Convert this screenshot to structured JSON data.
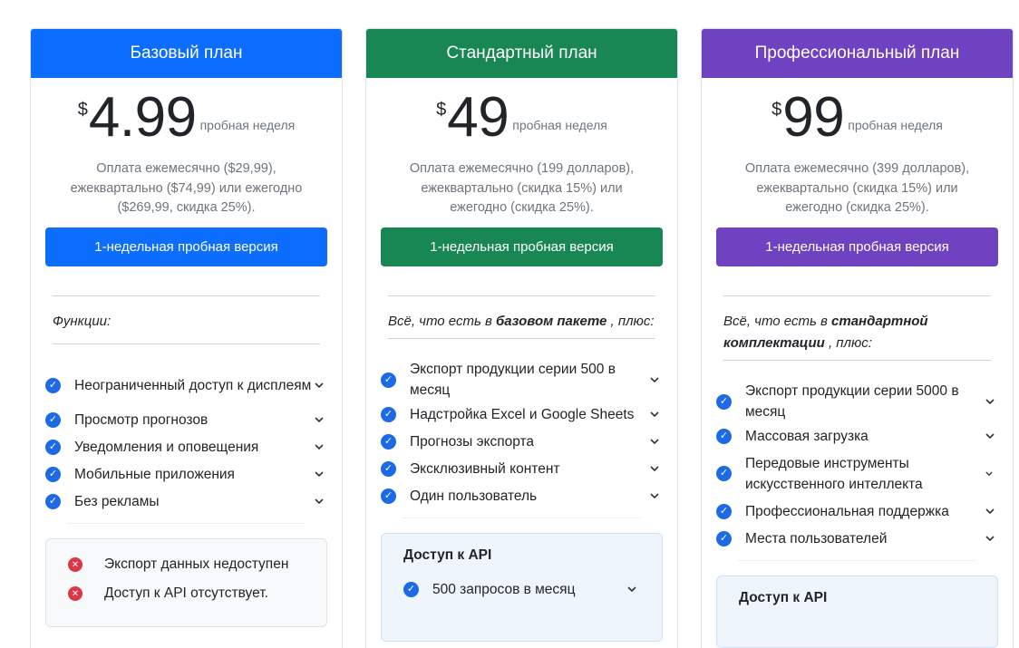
{
  "plans": [
    {
      "header": "Базовый план",
      "color": "#0d6efd",
      "currency": "$",
      "amount": "4.99",
      "period": "пробная неделя",
      "desc": [
        "Оплата ежемесячно ($29,99),",
        "ежеквартально ($74,99) или ежегодно",
        "($269,99, скидка 25%)."
      ],
      "cta": "1-недельная пробная версия",
      "intro_plain": "Функции:",
      "features": [
        "Неограниченный доступ к дисплеям",
        "Просмотр прогнозов",
        "Уведомления и оповещения",
        "Мобильные приложения",
        "Без рекламы"
      ],
      "negatives": [
        "Экспорт данных недоступен",
        "Доступ к API отсутствует."
      ]
    },
    {
      "header": "Стандартный план",
      "color": "#198754",
      "currency": "$",
      "amount": "49",
      "period": "пробная неделя",
      "desc": [
        "Оплата ежемесячно (199 долларов),",
        "ежеквартально (скидка 15%) или",
        "ежегодно (скидка 25%)."
      ],
      "cta": "1-недельная пробная версия",
      "intro_pre": "Всё, что есть в",
      "intro_bold": "базовом пакете",
      "intro_post": ", плюс:",
      "features": [
        "Экспорт продукции серии 500 в месяц",
        "Надстройка Excel и Google Sheets",
        "Прогнозы экспорта",
        "Эксклюзивный контент",
        "Один пользователь"
      ],
      "api_title": "Доступ к API",
      "api_features": [
        "500 запросов в месяц"
      ]
    },
    {
      "header": "Профессиональный план",
      "color": "#6f42c1",
      "currency": "$",
      "amount": "99",
      "period": "пробная неделя",
      "desc": [
        "Оплата ежемесячно (399 долларов),",
        "ежеквартально (скидка 15%) или",
        "ежегодно (скидка 25%)."
      ],
      "cta": "1-недельная пробная версия",
      "intro_pre": "Всё, что есть в",
      "intro_bold": "стандартной комплектации",
      "intro_post": ", плюс:",
      "features": [
        "Экспорт продукции серии 5000 в месяц",
        "Массовая загрузка",
        "Передовые инструменты искусственного интеллекта",
        "Профессиональная поддержка",
        "Места пользователей"
      ],
      "api_title": "Доступ к API"
    }
  ]
}
